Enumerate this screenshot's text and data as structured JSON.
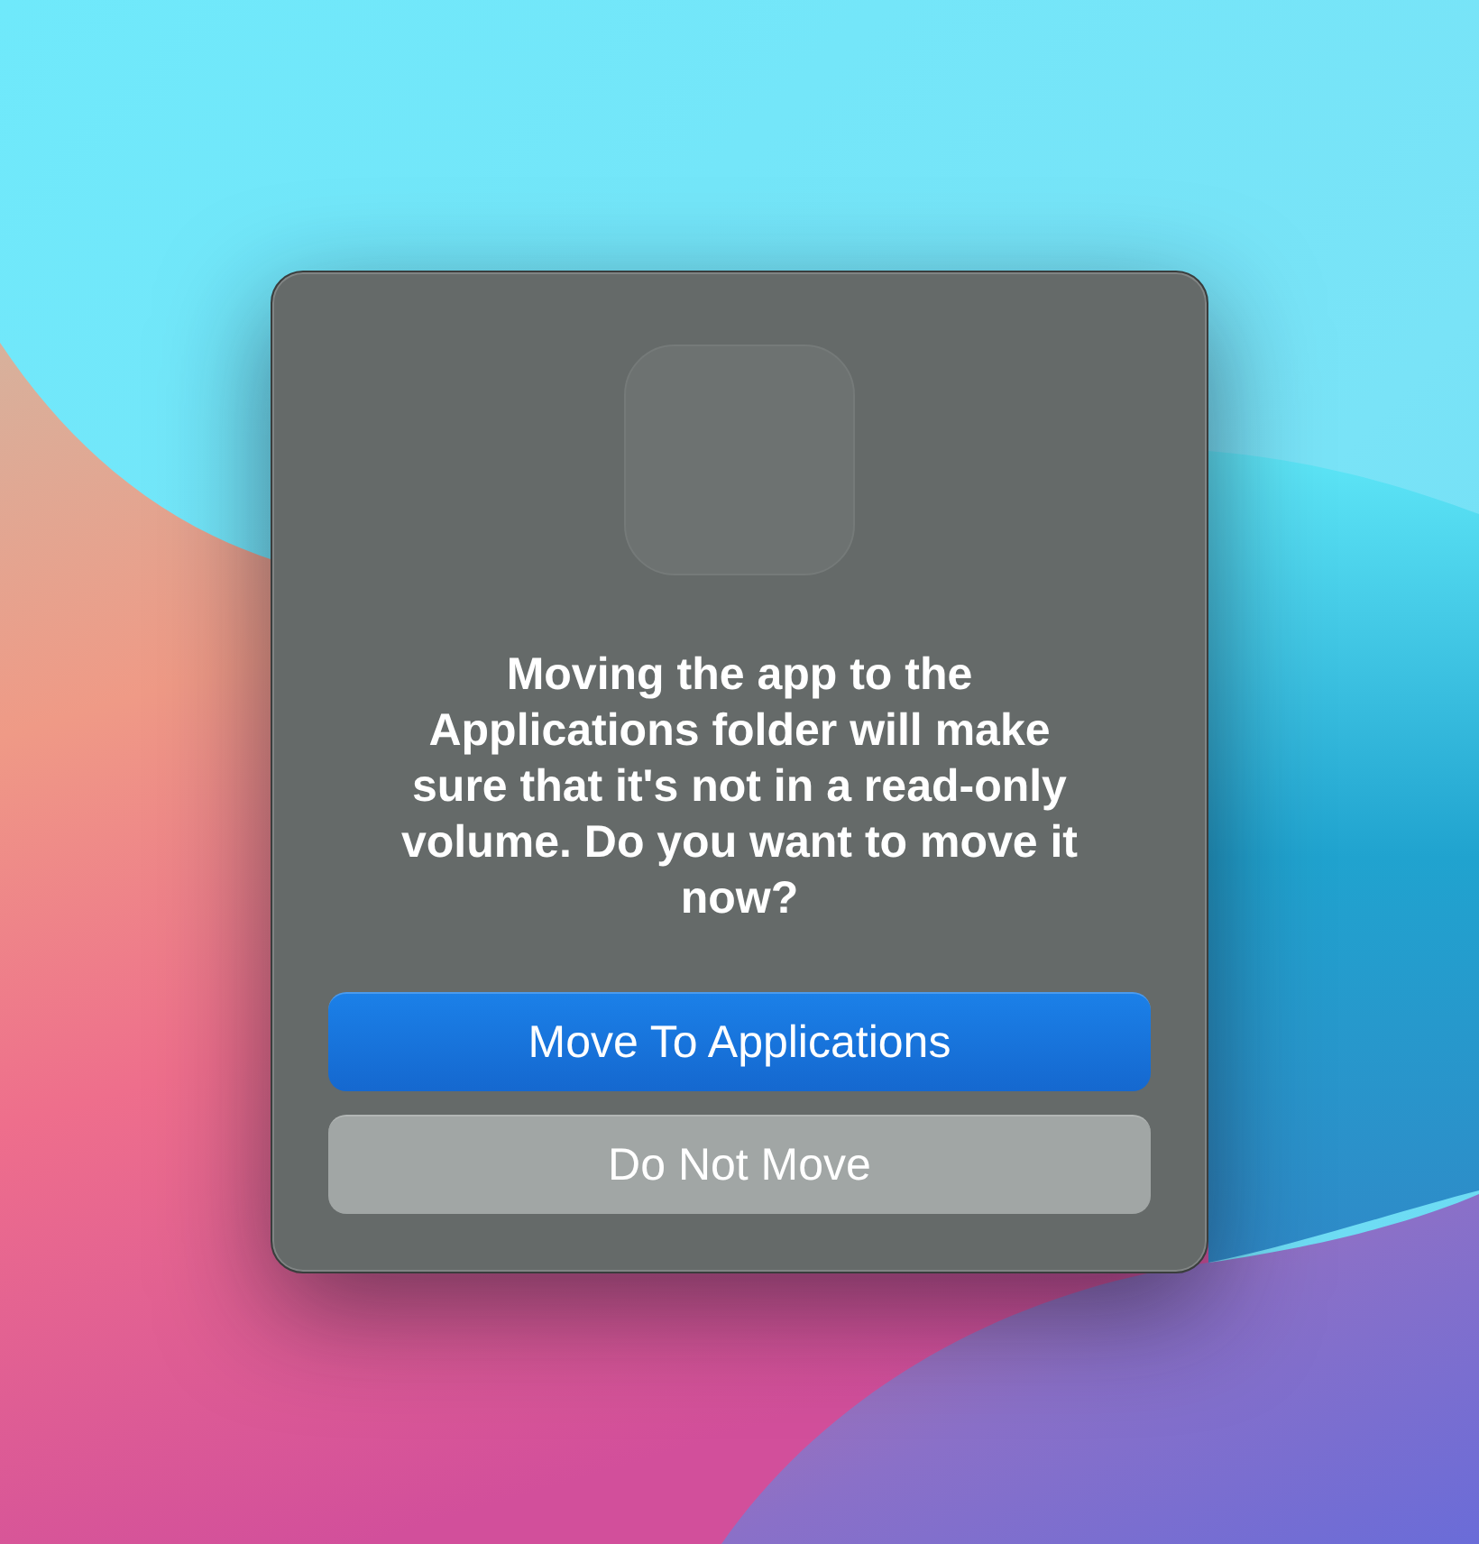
{
  "dialog": {
    "message": "Moving the app to the Applications folder will make sure that it's not in a read-only volume. Do you want to move it now?",
    "buttons": [
      {
        "label": "Move To Applications",
        "kind": "primary"
      },
      {
        "label": "Do Not Move",
        "kind": "secondary"
      }
    ]
  }
}
